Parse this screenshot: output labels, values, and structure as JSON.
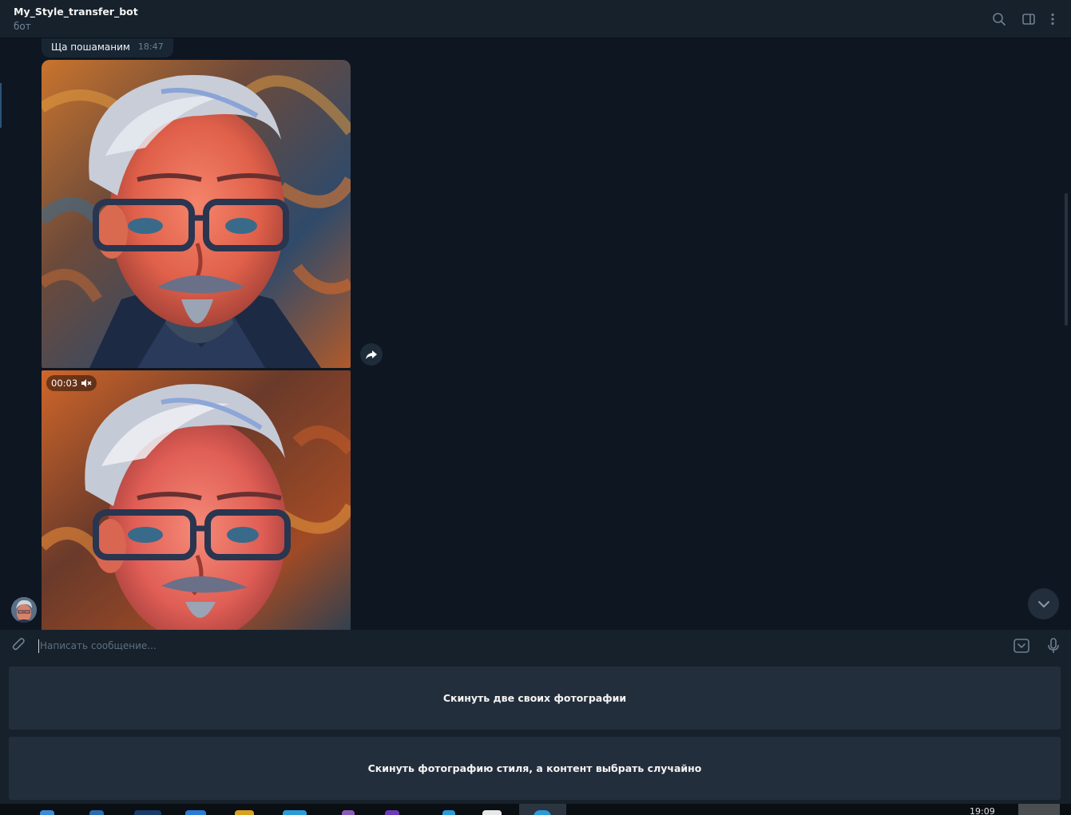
{
  "header": {
    "title": "My_Style_transfer_bot",
    "subtitle": "бот",
    "icons": [
      "search-icon",
      "sidebar-toggle-icon",
      "more-vertical-icon"
    ]
  },
  "messages": {
    "text_message": {
      "text": "Ща пошаманим",
      "time": "18:47"
    },
    "video_badge": {
      "duration": "00:03",
      "icon": "muted-speaker-icon"
    }
  },
  "input": {
    "placeholder": "Написать сообщение...",
    "value": ""
  },
  "keyboard": {
    "buttons": [
      {
        "label": "Скинуть две своих фотографии"
      },
      {
        "label": "Скинуть фотографию стиля, а контент выбрать случайно"
      }
    ]
  },
  "taskbar": {
    "clock": "19:09"
  },
  "colors": {
    "background": "#0e1621",
    "header": "#17212b",
    "bubble": "#182533",
    "button": "#232e3c",
    "muted_text": "#708499"
  }
}
